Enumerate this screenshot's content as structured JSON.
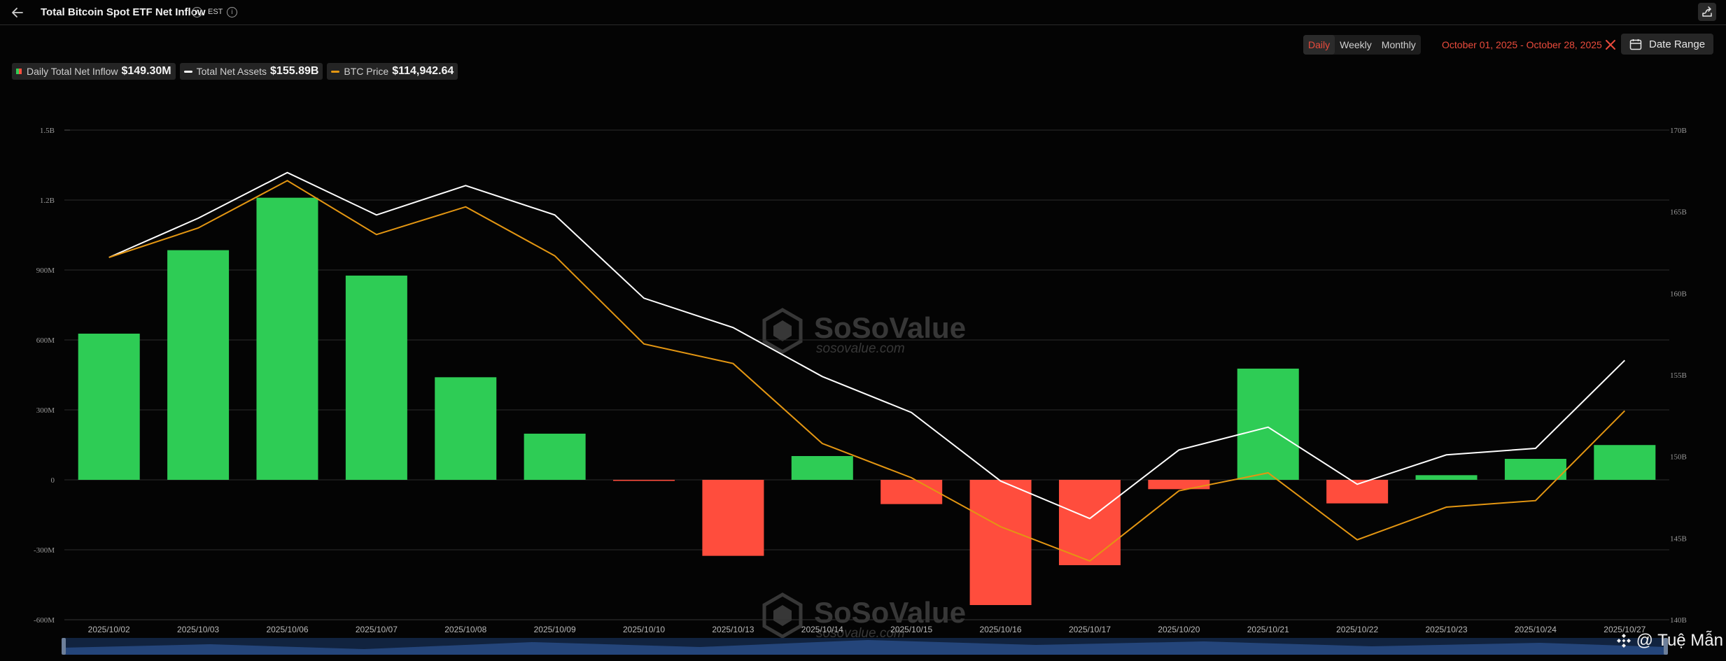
{
  "header": {
    "title": "Total Bitcoin Spot ETF Net Inflow",
    "timezone": "EST",
    "info_glyph": "i"
  },
  "controls": {
    "periods": [
      "Daily",
      "Weekly",
      "Monthly"
    ],
    "active_period": "Daily",
    "date_range_text": "October 01, 2025 - October 28, 2025",
    "date_range_button": "Date Range"
  },
  "legend": [
    {
      "name": "Daily Total Net Inflow",
      "value": "$149.30M"
    },
    {
      "name": "Total Net Assets",
      "value": "$155.89B"
    },
    {
      "name": "BTC Price",
      "value": "$114,942.64"
    }
  ],
  "watermark": {
    "brand": "SoSoValue",
    "url": "sosovalue.com"
  },
  "credit": "@ Tuệ Mẫn",
  "colors": {
    "positive_bar": "#2ecc55",
    "negative_bar": "#ff4d3d",
    "assets_line": "#ffffff",
    "price_line": "#e39612",
    "accent": "#ea4b3c"
  },
  "chart_data": {
    "type": "bar",
    "title": "Total Bitcoin Spot ETF Net Inflow",
    "categories": [
      "2025/10/02",
      "2025/10/03",
      "2025/10/06",
      "2025/10/07",
      "2025/10/08",
      "2025/10/09",
      "2025/10/10",
      "2025/10/13",
      "2025/10/14",
      "2025/10/15",
      "2025/10/16",
      "2025/10/17",
      "2025/10/20",
      "2025/10/21",
      "2025/10/22",
      "2025/10/23",
      "2025/10/24",
      "2025/10/27"
    ],
    "series": [
      {
        "name": "Daily Total Net Inflow",
        "type": "bar",
        "axis": "left",
        "values": [
          627,
          985,
          1210,
          876,
          440,
          198,
          -4.5,
          -326,
          102,
          -104,
          -537,
          -366,
          -40,
          477,
          -101,
          20,
          90,
          149.3
        ]
      },
      {
        "name": "Total Net Assets",
        "type": "line",
        "axis": "right",
        "values": [
          162.2,
          164.6,
          167.4,
          164.8,
          166.6,
          164.8,
          159.7,
          157.9,
          154.9,
          152.7,
          148.5,
          146.2,
          150.4,
          151.8,
          148.3,
          150.1,
          150.5,
          155.89
        ]
      },
      {
        "name": "BTC Price",
        "type": "line",
        "axis": "right",
        "values": [
          162.2,
          164.0,
          166.9,
          163.6,
          165.3,
          162.3,
          156.9,
          155.7,
          150.8,
          148.7,
          145.7,
          143.6,
          147.9,
          149.0,
          144.9,
          146.9,
          147.3,
          152.8
        ]
      }
    ],
    "y_left": {
      "ticks": [
        -600,
        -300,
        0,
        300,
        600,
        900,
        1200,
        1500
      ],
      "tick_labels": [
        "-600M",
        "-300M",
        "0",
        "300M",
        "600M",
        "900M",
        "1.2B",
        "1.5B"
      ],
      "range": [
        -600,
        1500
      ]
    },
    "y_right": {
      "ticks": [
        140,
        145,
        150,
        155,
        160,
        165,
        170
      ],
      "tick_labels": [
        "140B",
        "145B",
        "150B",
        "155B",
        "160B",
        "165B",
        "170B"
      ],
      "range": [
        140,
        170
      ]
    },
    "grid": true,
    "legend_placement": "top-left"
  }
}
